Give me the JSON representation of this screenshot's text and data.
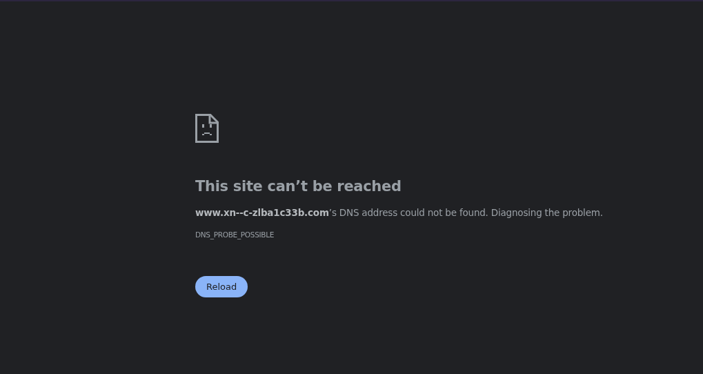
{
  "heading": "This site can’t be reached",
  "message": "**www.xn--c-zlba1c33b.com**’s DNS address could not be found. Diagnosing the problem.",
  "error_code": "DNS_PROBE_POSSIBLE",
  "buttons": [
    {
      "label": "Reload"
    }
  ]
}
